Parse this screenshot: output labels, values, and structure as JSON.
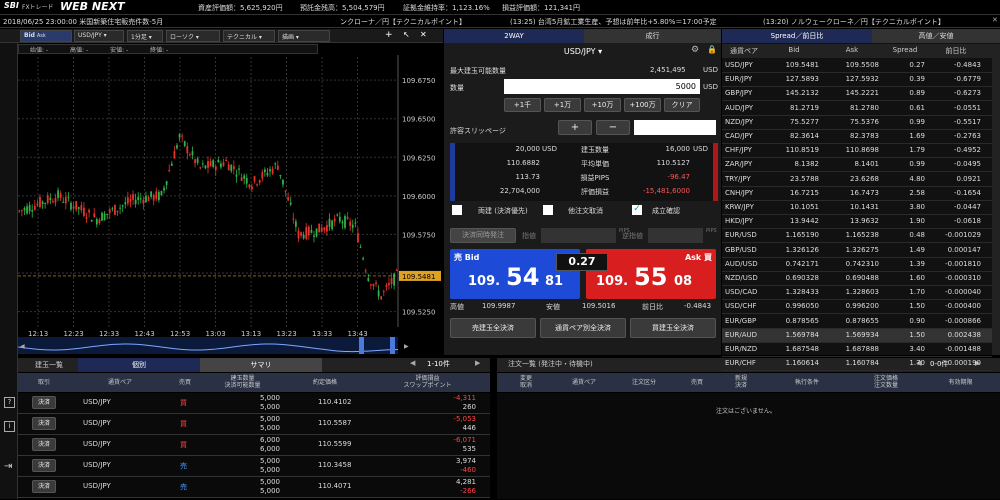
{
  "header": {
    "logo_sbi": "SBI",
    "logo_fx": "FXトレード",
    "logo_web": "WEB NEXT",
    "asset": "資産評価額：5,625,920円",
    "margin": "預託金残高：5,504,579円",
    "ratio": "証拠金維持率：1,123.16%",
    "pl": "損益評価額：121,341円"
  },
  "news": {
    "date": "2018/06/25 23:00:00 米国新築住宅販売件数-5月",
    "item1": "ンクローナ／円【テクニカルポイント】",
    "item2": "(13:25) 台湾5月鉱工業生産、予想は前年比+5.80%＝17:00予定",
    "item3": "(13:20) ノルウェークローネ／円【テクニカルポイント】"
  },
  "toolbar": {
    "bid": "Bid",
    "ask": "Ask",
    "pair": "USD/JPY",
    "interval": "1分足",
    "candle": "ローソク",
    "technical": "テクニカル",
    "draw": "描画"
  },
  "ohlc": {
    "open": "始値: -",
    "high": "高値: -",
    "low": "安値: -",
    "close": "終値: -"
  },
  "chart_data": {
    "type": "candlestick",
    "yticks": [
      "109.6750",
      "109.6500",
      "109.6250",
      "109.6000",
      "109.5750",
      "109.5500",
      "109.5250"
    ],
    "xticks": [
      "12:13",
      "12:23",
      "12:33",
      "12:43",
      "12:53",
      "13:03",
      "13:13",
      "13:23",
      "13:33",
      "13:43"
    ],
    "ylim": [
      109.515,
      109.69
    ],
    "current": "109.5481"
  },
  "order": {
    "tab_2way": "2WAY",
    "tab_market": "成行",
    "pair": "USD/JPY",
    "max_label": "最大建玉可能数量",
    "max_val": "2,451,495",
    "max_unit": "USD",
    "qty_label": "数量",
    "qty_val": "5000",
    "qty_unit": "USD",
    "b1": "+1千",
    "b2": "+1万",
    "b3": "+10万",
    "b4": "+100万",
    "clear": "クリア",
    "slip_label": "許容スリッページ",
    "plus": "+",
    "minus": "−",
    "info": [
      {
        "v1": "20,000",
        "u1": "USD",
        "l": "建玉数量",
        "v2": "16,000",
        "u2": "USD"
      },
      {
        "v1": "110.6882",
        "u1": "",
        "l": "平均単価",
        "v2": "110.5127",
        "u2": ""
      },
      {
        "v1": "113.73",
        "u1": "",
        "l": "損益PIPS",
        "v2": "-96.47",
        "u2": ""
      },
      {
        "v1": "22,704,000",
        "u1": "",
        "l": "評価損益",
        "v2": "-15,481,6000",
        "u2": ""
      }
    ],
    "chk1": "両建 (決済優先)",
    "chk2": "他注文取消",
    "chk3": "成立確認",
    "simul": "決済同時発注",
    "sashine": "指値",
    "gyaku": "逆指値",
    "pips": "PIPS",
    "sell_label": "売 Bid",
    "buy_label": "Ask 買",
    "spread": "0.27",
    "bid_pre": "109.",
    "bid_big": "54",
    "bid_small": "81",
    "ask_pre": "109.",
    "ask_big": "55",
    "ask_small": "08",
    "high_label": "高値",
    "high": "109.9987",
    "low_label": "安値",
    "low": "109.5016",
    "prev_label": "前日比",
    "prev": "-0.4843",
    "all_sell": "売建玉全決済",
    "pair_close": "通貨ペア別全決済",
    "all_buy": "買建玉全決済"
  },
  "rates": {
    "tab1": "Spread／前日比",
    "tab2": "高値／安値",
    "cols": [
      "通貨ペア",
      "Bid",
      "Ask",
      "Spread",
      "前日比"
    ],
    "rows": [
      [
        "USD/JPY",
        "109.5481",
        "109.5508",
        "0.27",
        "-0.4843"
      ],
      [
        "EUR/JPY",
        "127.5893",
        "127.5932",
        "0.39",
        "-0.6779"
      ],
      [
        "GBP/JPY",
        "145.2132",
        "145.2221",
        "0.89",
        "-0.6273"
      ],
      [
        "AUD/JPY",
        "81.2719",
        "81.2780",
        "0.61",
        "-0.0551"
      ],
      [
        "NZD/JPY",
        "75.5277",
        "75.5376",
        "0.99",
        "-0.5517"
      ],
      [
        "CAD/JPY",
        "82.3614",
        "82.3783",
        "1.69",
        "-0.2763"
      ],
      [
        "CHF/JPY",
        "110.8519",
        "110.8698",
        "1.79",
        "-0.4952"
      ],
      [
        "ZAR/JPY",
        "8.1382",
        "8.1401",
        "0.99",
        "-0.0495"
      ],
      [
        "TRY/JPY",
        "23.5788",
        "23.6268",
        "4.80",
        "0.0921"
      ],
      [
        "CNH/JPY",
        "16.7215",
        "16.7473",
        "2.58",
        "-0.1654"
      ],
      [
        "KRW/JPY",
        "10.1051",
        "10.1431",
        "3.80",
        "-0.0447"
      ],
      [
        "HKD/JPY",
        "13.9442",
        "13.9632",
        "1.90",
        "-0.0618"
      ],
      [
        "EUR/USD",
        "1.165190",
        "1.165238",
        "0.48",
        "-0.001029"
      ],
      [
        "GBP/USD",
        "1.326126",
        "1.326275",
        "1.49",
        "0.000147"
      ],
      [
        "AUD/USD",
        "0.742171",
        "0.742310",
        "1.39",
        "-0.001810"
      ],
      [
        "NZD/USD",
        "0.690328",
        "0.690488",
        "1.60",
        "-0.000310"
      ],
      [
        "USD/CAD",
        "1.328433",
        "1.328603",
        "1.70",
        "-0.000040"
      ],
      [
        "USD/CHF",
        "0.996050",
        "0.996200",
        "1.50",
        "-0.000400"
      ],
      [
        "EUR/GBP",
        "0.878565",
        "0.878655",
        "0.90",
        "-0.000866"
      ],
      [
        "EUR/AUD",
        "1.569784",
        "1.569934",
        "1.50",
        "0.002438"
      ],
      [
        "EUR/NZD",
        "1.687548",
        "1.687888",
        "3.40",
        "-0.001488"
      ],
      [
        "EUR/CHF",
        "1.160614",
        "1.160784",
        "1.70",
        "-0.000190"
      ]
    ]
  },
  "positions": {
    "tab1": "建玉一覧",
    "tab2": "個別",
    "tab3": "サマリ",
    "pager": "1-10件",
    "cols": [
      "取引",
      "通貨ペア",
      "売買",
      "建玉数量\n決済可能数量",
      "約定価格",
      "評価損益\nスワップポイント"
    ],
    "rows": [
      {
        "btn": "決済",
        "pair": "USD/JPY",
        "side": "買",
        "q1": "5,000",
        "q2": "5,000",
        "price": "110.4102",
        "pl": "-4,311",
        "swap": "260"
      },
      {
        "btn": "決済",
        "pair": "USD/JPY",
        "side": "買",
        "q1": "5,000",
        "q2": "5,000",
        "price": "110.5587",
        "pl": "-5,053",
        "swap": "446"
      },
      {
        "btn": "決済",
        "pair": "USD/JPY",
        "side": "買",
        "q1": "6,000",
        "q2": "6,000",
        "price": "110.5599",
        "pl": "-6,071",
        "swap": "535"
      },
      {
        "btn": "決済",
        "pair": "USD/JPY",
        "side": "売",
        "q1": "5,000",
        "q2": "5,000",
        "price": "110.3458",
        "pl": "3,974",
        "swap": "-460"
      },
      {
        "btn": "決済",
        "pair": "USD/JPY",
        "side": "売",
        "q1": "5,000",
        "q2": "5,000",
        "price": "110.4071",
        "pl": "4,281",
        "swap": "-266"
      }
    ]
  },
  "orders": {
    "tab": "注文一覧 (発注中・待機中)",
    "pager": "0-0件",
    "cols": [
      "変更\n取消",
      "通貨ペア",
      "注文区分",
      "売買",
      "新規\n決済",
      "執行条件",
      "注文価格\n注文数量",
      "有効期限"
    ],
    "empty": "注文はございません。"
  }
}
